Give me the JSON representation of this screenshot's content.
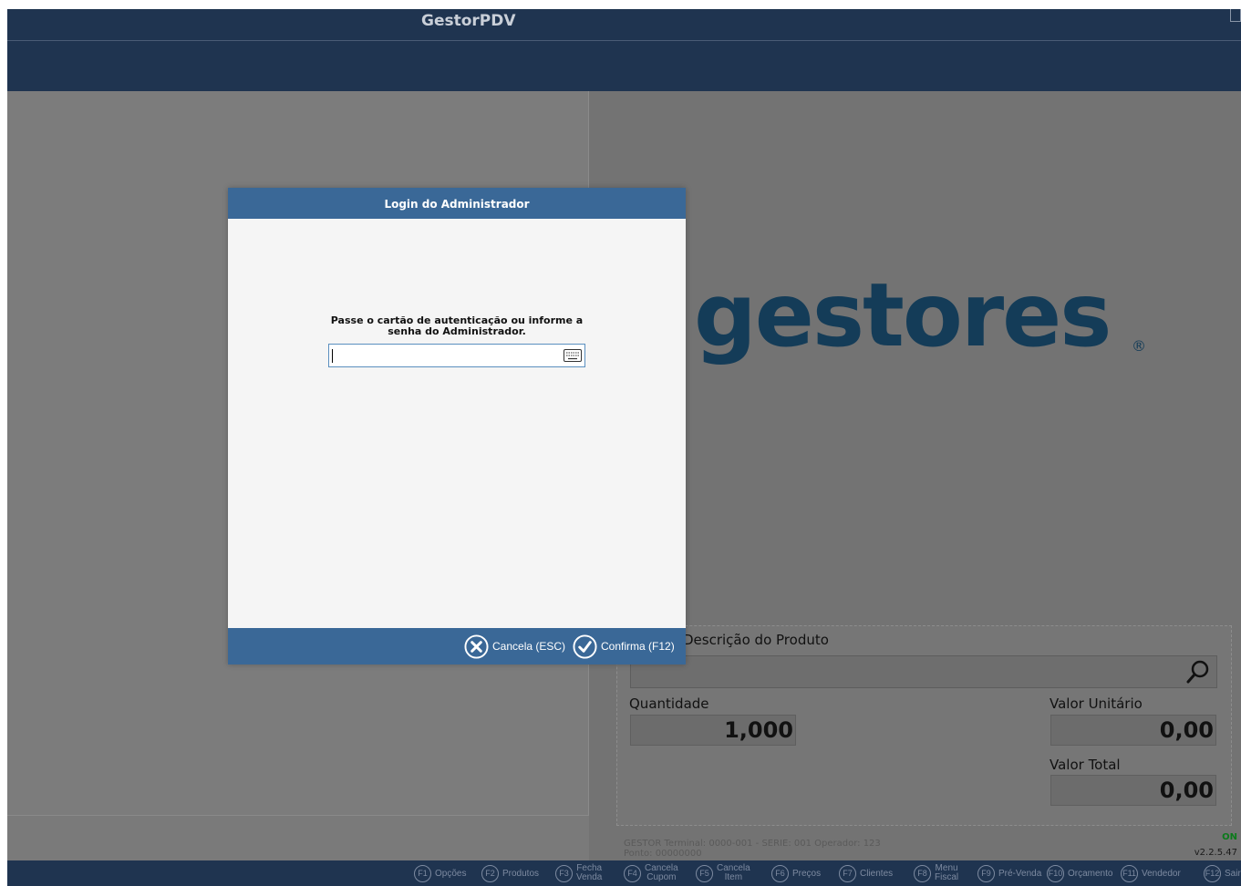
{
  "window": {
    "title": "GestorPDV"
  },
  "logo": {
    "text": "gestores",
    "registered": "®"
  },
  "product": {
    "description_label": "Descrição do Produto",
    "description_value": "",
    "quantity_label": "Quantidade",
    "quantity_value": "1,000",
    "unit_price_label": "Valor Unitário",
    "unit_price_value": "0,00",
    "total_label": "Valor Total",
    "total_value": "0,00"
  },
  "status": {
    "online": "ON",
    "version": "v2.2.5.47",
    "info_line1": "GESTOR     Terminal: 0000-001 - SERIE: 001     Operador: 123",
    "info_line2": "Ponto: 00000000"
  },
  "dialog": {
    "title": "Login do Administrador",
    "message": "Passe o cartão de autenticação ou informe a senha do Administrador.",
    "password_value": "",
    "cancel_label": "Cancela (ESC)",
    "confirm_label": "Confirma (F12)"
  },
  "function_keys": [
    {
      "key": "F1",
      "label": "Opções"
    },
    {
      "key": "F2",
      "label": "Produtos"
    },
    {
      "key": "F3",
      "line1": "Fecha",
      "line2": "Venda"
    },
    {
      "key": "F4",
      "line1": "Cancela",
      "line2": "Cupom"
    },
    {
      "key": "F5",
      "line1": "Cancela",
      "line2": "Item"
    },
    {
      "key": "F6",
      "label": "Preços"
    },
    {
      "key": "F7",
      "label": "Clientes"
    },
    {
      "key": "F8",
      "line1": "Menu",
      "line2": "Fiscal"
    },
    {
      "key": "F9",
      "label": "Pré-Venda"
    },
    {
      "key": "F10",
      "label": "Orçamento"
    },
    {
      "key": "F11",
      "label": "Vendedor"
    },
    {
      "key": "F12",
      "label": "Sair"
    }
  ],
  "colors": {
    "titlebar": "#1f3450",
    "dialog_header": "#3a6897",
    "logo": "#143c58",
    "online": "#0a7a1a"
  },
  "icons": {
    "search": "magnifier-icon",
    "keyboard": "keyboard-icon",
    "cancel": "cancel-circle-icon",
    "confirm": "check-circle-icon"
  }
}
